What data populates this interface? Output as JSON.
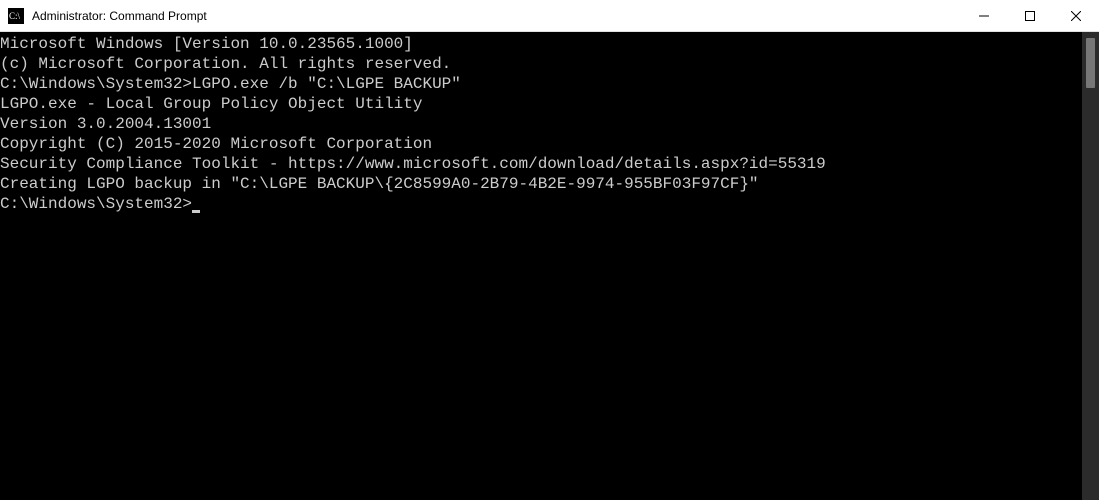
{
  "window": {
    "title": "Administrator: Command Prompt"
  },
  "terminal": {
    "lines": [
      "Microsoft Windows [Version 10.0.23565.1000]",
      "(c) Microsoft Corporation. All rights reserved.",
      "",
      "C:\\Windows\\System32>LGPO.exe /b \"C:\\LGPE BACKUP\"",
      "",
      "LGPO.exe - Local Group Policy Object Utility",
      "Version 3.0.2004.13001",
      "Copyright (C) 2015-2020 Microsoft Corporation",
      "Security Compliance Toolkit - https://www.microsoft.com/download/details.aspx?id=55319",
      "",
      "Creating LGPO backup in \"C:\\LGPE BACKUP\\{2C8599A0-2B79-4B2E-9974-955BF03F97CF}\"",
      "",
      "C:\\Windows\\System32>"
    ],
    "prompt_has_cursor": true
  }
}
